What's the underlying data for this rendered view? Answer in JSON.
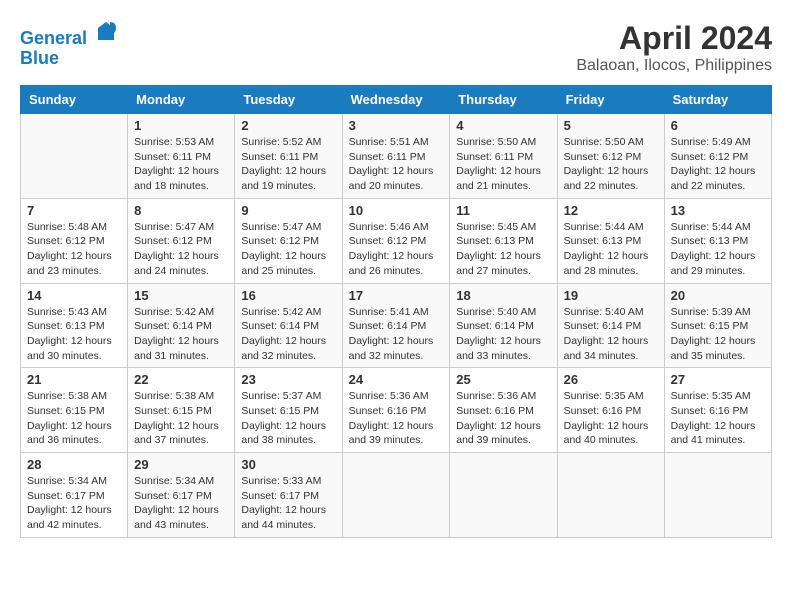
{
  "header": {
    "logo_line1": "General",
    "logo_line2": "Blue",
    "title": "April 2024",
    "subtitle": "Balaoan, Ilocos, Philippines"
  },
  "calendar": {
    "days_of_week": [
      "Sunday",
      "Monday",
      "Tuesday",
      "Wednesday",
      "Thursday",
      "Friday",
      "Saturday"
    ],
    "weeks": [
      [
        {
          "day": "",
          "info": ""
        },
        {
          "day": "1",
          "info": "Sunrise: 5:53 AM\nSunset: 6:11 PM\nDaylight: 12 hours\nand 18 minutes."
        },
        {
          "day": "2",
          "info": "Sunrise: 5:52 AM\nSunset: 6:11 PM\nDaylight: 12 hours\nand 19 minutes."
        },
        {
          "day": "3",
          "info": "Sunrise: 5:51 AM\nSunset: 6:11 PM\nDaylight: 12 hours\nand 20 minutes."
        },
        {
          "day": "4",
          "info": "Sunrise: 5:50 AM\nSunset: 6:11 PM\nDaylight: 12 hours\nand 21 minutes."
        },
        {
          "day": "5",
          "info": "Sunrise: 5:50 AM\nSunset: 6:12 PM\nDaylight: 12 hours\nand 22 minutes."
        },
        {
          "day": "6",
          "info": "Sunrise: 5:49 AM\nSunset: 6:12 PM\nDaylight: 12 hours\nand 22 minutes."
        }
      ],
      [
        {
          "day": "7",
          "info": "Sunrise: 5:48 AM\nSunset: 6:12 PM\nDaylight: 12 hours\nand 23 minutes."
        },
        {
          "day": "8",
          "info": "Sunrise: 5:47 AM\nSunset: 6:12 PM\nDaylight: 12 hours\nand 24 minutes."
        },
        {
          "day": "9",
          "info": "Sunrise: 5:47 AM\nSunset: 6:12 PM\nDaylight: 12 hours\nand 25 minutes."
        },
        {
          "day": "10",
          "info": "Sunrise: 5:46 AM\nSunset: 6:12 PM\nDaylight: 12 hours\nand 26 minutes."
        },
        {
          "day": "11",
          "info": "Sunrise: 5:45 AM\nSunset: 6:13 PM\nDaylight: 12 hours\nand 27 minutes."
        },
        {
          "day": "12",
          "info": "Sunrise: 5:44 AM\nSunset: 6:13 PM\nDaylight: 12 hours\nand 28 minutes."
        },
        {
          "day": "13",
          "info": "Sunrise: 5:44 AM\nSunset: 6:13 PM\nDaylight: 12 hours\nand 29 minutes."
        }
      ],
      [
        {
          "day": "14",
          "info": "Sunrise: 5:43 AM\nSunset: 6:13 PM\nDaylight: 12 hours\nand 30 minutes."
        },
        {
          "day": "15",
          "info": "Sunrise: 5:42 AM\nSunset: 6:14 PM\nDaylight: 12 hours\nand 31 minutes."
        },
        {
          "day": "16",
          "info": "Sunrise: 5:42 AM\nSunset: 6:14 PM\nDaylight: 12 hours\nand 32 minutes."
        },
        {
          "day": "17",
          "info": "Sunrise: 5:41 AM\nSunset: 6:14 PM\nDaylight: 12 hours\nand 32 minutes."
        },
        {
          "day": "18",
          "info": "Sunrise: 5:40 AM\nSunset: 6:14 PM\nDaylight: 12 hours\nand 33 minutes."
        },
        {
          "day": "19",
          "info": "Sunrise: 5:40 AM\nSunset: 6:14 PM\nDaylight: 12 hours\nand 34 minutes."
        },
        {
          "day": "20",
          "info": "Sunrise: 5:39 AM\nSunset: 6:15 PM\nDaylight: 12 hours\nand 35 minutes."
        }
      ],
      [
        {
          "day": "21",
          "info": "Sunrise: 5:38 AM\nSunset: 6:15 PM\nDaylight: 12 hours\nand 36 minutes."
        },
        {
          "day": "22",
          "info": "Sunrise: 5:38 AM\nSunset: 6:15 PM\nDaylight: 12 hours\nand 37 minutes."
        },
        {
          "day": "23",
          "info": "Sunrise: 5:37 AM\nSunset: 6:15 PM\nDaylight: 12 hours\nand 38 minutes."
        },
        {
          "day": "24",
          "info": "Sunrise: 5:36 AM\nSunset: 6:16 PM\nDaylight: 12 hours\nand 39 minutes."
        },
        {
          "day": "25",
          "info": "Sunrise: 5:36 AM\nSunset: 6:16 PM\nDaylight: 12 hours\nand 39 minutes."
        },
        {
          "day": "26",
          "info": "Sunrise: 5:35 AM\nSunset: 6:16 PM\nDaylight: 12 hours\nand 40 minutes."
        },
        {
          "day": "27",
          "info": "Sunrise: 5:35 AM\nSunset: 6:16 PM\nDaylight: 12 hours\nand 41 minutes."
        }
      ],
      [
        {
          "day": "28",
          "info": "Sunrise: 5:34 AM\nSunset: 6:17 PM\nDaylight: 12 hours\nand 42 minutes."
        },
        {
          "day": "29",
          "info": "Sunrise: 5:34 AM\nSunset: 6:17 PM\nDaylight: 12 hours\nand 43 minutes."
        },
        {
          "day": "30",
          "info": "Sunrise: 5:33 AM\nSunset: 6:17 PM\nDaylight: 12 hours\nand 44 minutes."
        },
        {
          "day": "",
          "info": ""
        },
        {
          "day": "",
          "info": ""
        },
        {
          "day": "",
          "info": ""
        },
        {
          "day": "",
          "info": ""
        }
      ]
    ]
  }
}
